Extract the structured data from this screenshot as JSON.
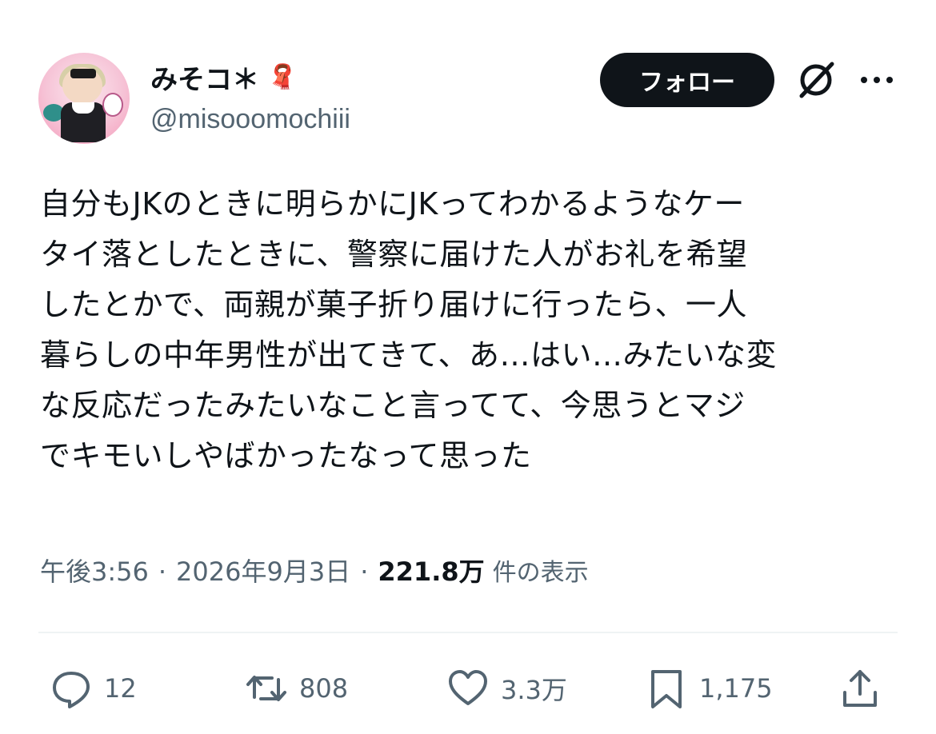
{
  "author": {
    "display_name": "みそコ＊",
    "name_emoji": "🧣",
    "handle": "@misooomochiii"
  },
  "header": {
    "follow_label": "フォロー"
  },
  "tweet": {
    "text": "自分もJKのときに明らかにJKってわかるようなケー\nタイ落としたときに、警察に届けた人がお礼を希望\nしたとかで、両親が菓子折り届けに行ったら、一人\n暮らしの中年男性が出てきて、あ…はい…みたいな変\nな反応だったみたいなこと言ってて、今思うとマジ\nでキモいしやばかったなって思った"
  },
  "meta": {
    "time": "午後3:56",
    "separator": "·",
    "date": "2026年9月3日",
    "views_count": "221.8万",
    "views_label": "件の表示"
  },
  "actions": {
    "replies": "12",
    "reposts": "808",
    "likes": "3.3万",
    "bookmarks": "1,175"
  },
  "colors": {
    "text_primary": "#0f1419",
    "text_secondary": "#536471",
    "follow_bg": "#0f1419"
  }
}
